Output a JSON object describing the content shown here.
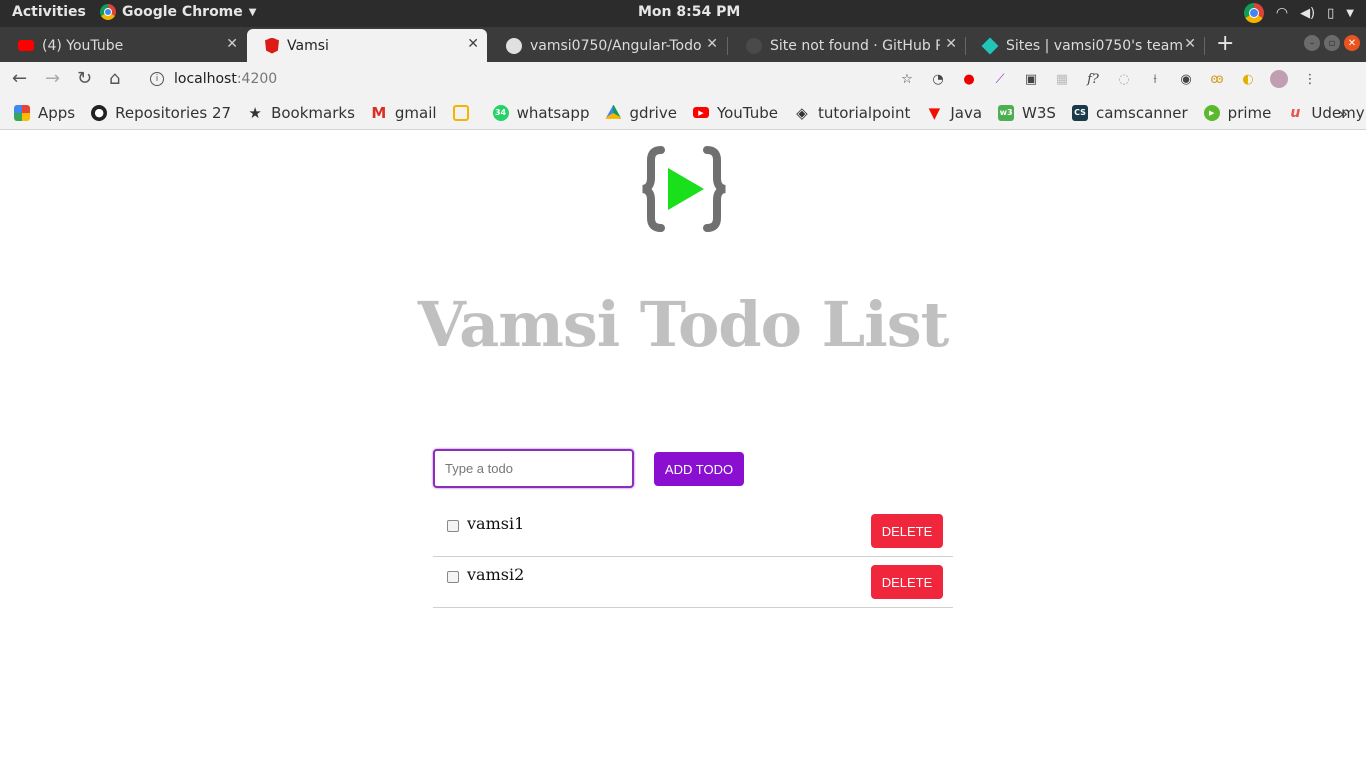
{
  "system_bar": {
    "activities": "Activities",
    "app_name": "Google Chrome",
    "clock": "Mon  8:54 PM"
  },
  "tabs": [
    {
      "title": "(4) YouTube",
      "icon": "youtube-icon",
      "active": false
    },
    {
      "title": "Vamsi",
      "icon": "angular-icon",
      "active": true
    },
    {
      "title": "vamsi0750/Angular-Todo",
      "icon": "github-icon",
      "active": false
    },
    {
      "title": "Site not found · GitHub Pa",
      "icon": "github-icon",
      "active": false
    },
    {
      "title": "Sites | vamsi0750's team",
      "icon": "netlify-icon",
      "active": false
    }
  ],
  "address_bar": {
    "host": "localhost",
    "port": ":4200"
  },
  "bookmarks": [
    {
      "label": "Apps",
      "icon": "apps-grid-icon"
    },
    {
      "label": "Repositories 27",
      "icon": "github-icon"
    },
    {
      "label": "Bookmarks",
      "icon": "star-icon"
    },
    {
      "label": "gmail",
      "icon": "gmail-icon"
    },
    {
      "label": "",
      "icon": "slides-icon"
    },
    {
      "label": "whatsapp",
      "icon": "whatsapp-icon"
    },
    {
      "label": "gdrive",
      "icon": "gdrive-icon"
    },
    {
      "label": "YouTube",
      "icon": "youtube-icon"
    },
    {
      "label": "tutorialpoint",
      "icon": "tutorialpoint-icon"
    },
    {
      "label": "Java",
      "icon": "java-icon"
    },
    {
      "label": "W3S",
      "icon": "w3s-icon"
    },
    {
      "label": "camscanner",
      "icon": "camscanner-icon"
    },
    {
      "label": "prime",
      "icon": "prime-icon"
    },
    {
      "label": "Udemy",
      "icon": "udemy-icon"
    }
  ],
  "app": {
    "heading": "Vamsi Todo List",
    "input_placeholder": "Type a todo",
    "add_button": "ADD TODO",
    "todos": [
      {
        "text": "vamsi1",
        "done": false,
        "delete_label": "DELETE"
      },
      {
        "text": "vamsi2",
        "done": false,
        "delete_label": "DELETE"
      }
    ],
    "colors": {
      "logo_bracket": "#707070",
      "logo_play": "#19e01a",
      "heading": "#c0c0c0",
      "add_button": "#8a0fd0",
      "delete_button": "#f0263c"
    }
  }
}
